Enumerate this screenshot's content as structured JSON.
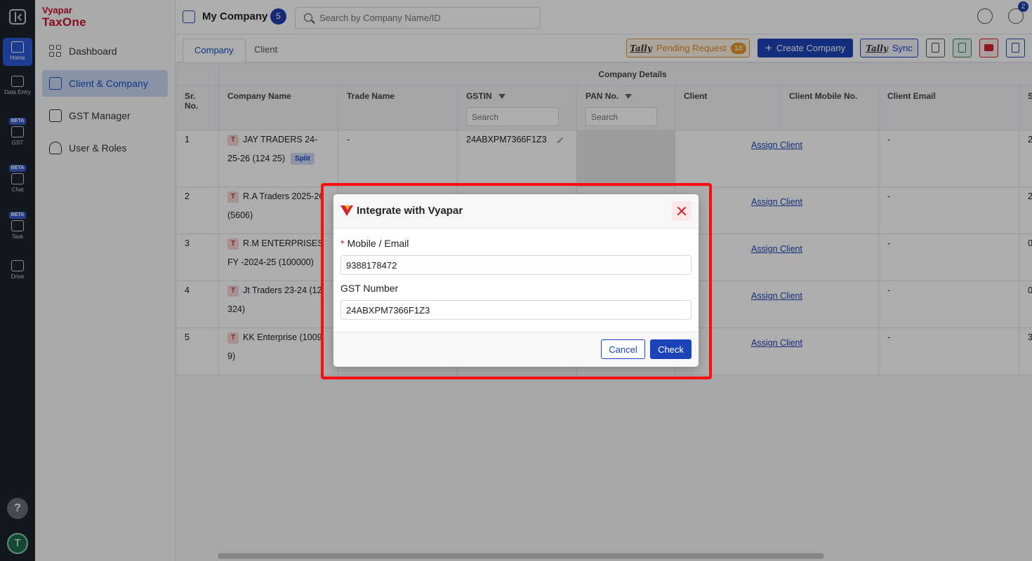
{
  "rail": {
    "items": [
      {
        "label": "Home",
        "beta": ""
      },
      {
        "label": "Data Entry",
        "beta": ""
      },
      {
        "label": "GST",
        "beta": "BETA"
      },
      {
        "label": "Chat",
        "beta": "BETA"
      },
      {
        "label": "Task",
        "beta": "BETA"
      },
      {
        "label": "Drive",
        "beta": ""
      }
    ],
    "help": "?",
    "avatar": "T"
  },
  "brand": {
    "top": "Vyapar",
    "bottom": "TaxOne"
  },
  "sidebar": {
    "items": [
      {
        "label": "Dashboard"
      },
      {
        "label": "Client & Company"
      },
      {
        "label": "GST Manager"
      },
      {
        "label": "User & Roles"
      }
    ]
  },
  "header": {
    "title": "My Company",
    "count": "5",
    "search_placeholder": "Search by Company Name/ID",
    "notification_count": "2"
  },
  "tabs": [
    {
      "label": "Company"
    },
    {
      "label": "Client"
    }
  ],
  "toolbar": {
    "tally_logo": "Tally",
    "pending_label": "Pending Request",
    "pending_count": "18",
    "create_label": "Create Company",
    "sync_label": "Sync"
  },
  "table": {
    "group_header": "Company Details",
    "headers": {
      "sr": "Sr. No.",
      "company": "Company Name",
      "trade": "Trade Name",
      "gstin": "GSTIN",
      "pan": "PAN No.",
      "client": "Client",
      "mobile": "Client Mobile No.",
      "email": "Client Email",
      "extra": "S"
    },
    "search_placeholder": "Search",
    "split_label": "Split",
    "badge": "T",
    "assign_label": "Assign Client",
    "rows": [
      {
        "sr": "1",
        "company": "JAY TRADERS 24-25-26 (124 25)",
        "trade": "-",
        "gstin": "24ABXPM7366F1Z3",
        "email": "-",
        "extra": "2"
      },
      {
        "sr": "2",
        "company": "R.A Traders 2025-26 (5606)",
        "trade": "",
        "gstin": "",
        "email": "-",
        "extra": "2"
      },
      {
        "sr": "3",
        "company": "R.M ENTERPRISES FY -2024-25 (100000)",
        "trade": "",
        "gstin": "",
        "email": "-",
        "extra": "0"
      },
      {
        "sr": "4",
        "company": "Jt Traders 23-24 (12 324)",
        "trade": "",
        "gstin": "",
        "email": "-",
        "extra": "0"
      },
      {
        "sr": "5",
        "company": "KK Enterprise (1009 9)",
        "trade": "",
        "gstin": "",
        "email": "-",
        "extra": "3"
      }
    ]
  },
  "modal": {
    "title": "Integrate with Vyapar",
    "required_mark": "*",
    "mobile_label": "Mobile / Email",
    "mobile_value": "9388178472",
    "gst_label": "GST Number",
    "gst_value": "24ABXPM7366F1Z3",
    "cancel_label": "Cancel",
    "check_label": "Check"
  },
  "colors": {
    "accent": "#1c44b8",
    "brand": "#c8102e",
    "highlight": "#ff0d0d"
  }
}
